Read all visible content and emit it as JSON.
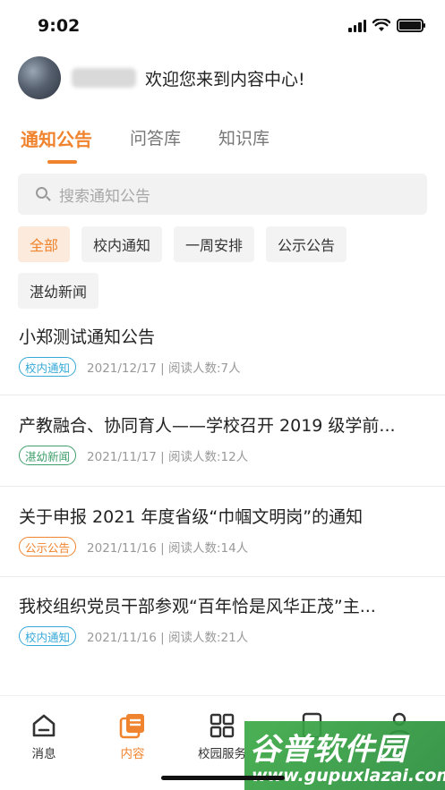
{
  "status_bar": {
    "time": "9:02"
  },
  "header": {
    "welcome": "欢迎您来到内容中心!"
  },
  "tabs": [
    {
      "label": "通知公告",
      "active": true
    },
    {
      "label": "问答库",
      "active": false
    },
    {
      "label": "知识库",
      "active": false
    }
  ],
  "search": {
    "placeholder": "搜索通知公告"
  },
  "filters": [
    {
      "label": "全部",
      "active": true
    },
    {
      "label": "校内通知",
      "active": false
    },
    {
      "label": "一周安排",
      "active": false
    },
    {
      "label": "公示公告",
      "active": false
    },
    {
      "label": "湛幼新闻",
      "active": false
    }
  ],
  "news": [
    {
      "title": "小郑测试通知公告",
      "tag": "校内通知",
      "tag_color": "#36a9d8",
      "meta": "2021/12/17 | 阅读人数:7人"
    },
    {
      "title": "产教融合、协同育人——学校召开 2019 级学前...",
      "tag": "湛幼新闻",
      "tag_color": "#3f9f6a",
      "meta": "2021/11/17 | 阅读人数:12人"
    },
    {
      "title": "关于申报 2021 年度省级“巾帼文明岗”的通知",
      "tag": "公示公告",
      "tag_color": "#f0832d",
      "meta": "2021/11/16 | 阅读人数:14人"
    },
    {
      "title": "我校组织党员干部参观“百年恰是风华正茂”主...",
      "tag": "校内通知",
      "tag_color": "#36a9d8",
      "meta": "2021/11/16 | 阅读人数:21人"
    }
  ],
  "tabbar": [
    {
      "label": "消息",
      "icon": "home-icon",
      "active": false
    },
    {
      "label": "内容",
      "icon": "document-icon",
      "active": true
    },
    {
      "label": "校园服务",
      "icon": "grid-icon",
      "active": false
    },
    {
      "label": "",
      "icon": "book-icon",
      "active": false
    },
    {
      "label": "",
      "icon": "user-icon",
      "active": false
    }
  ],
  "watermark": {
    "line1": "谷普软件园",
    "line2": "www.gupuxlazai.com"
  },
  "colors": {
    "accent": "#f0832d",
    "tag_blue": "#36a9d8",
    "tag_green": "#3f9f6a"
  }
}
